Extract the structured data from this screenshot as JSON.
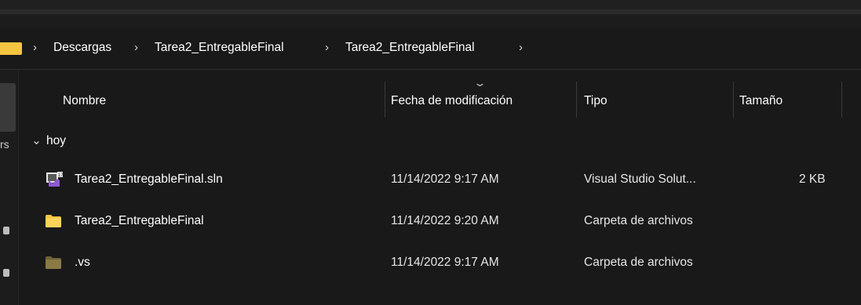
{
  "breadcrumb": {
    "items": [
      "Descargas",
      "Tarea2_EntregableFinal",
      "Tarea2_EntregableFinal"
    ],
    "separator": "›"
  },
  "leftpane": {
    "truncated_text": "rs"
  },
  "columns": {
    "name": "Nombre",
    "modified": "Fecha de modificación",
    "type": "Tipo",
    "size": "Tamaño"
  },
  "group": {
    "label": "hoy",
    "chevron": "⌄"
  },
  "files": [
    {
      "name": "Tarea2_EntregableFinal.sln",
      "modified": "11/14/2022 9:17 AM",
      "type": "Visual Studio Solut...",
      "size": "2 KB",
      "icon": "visual-studio-solution-icon"
    },
    {
      "name": "Tarea2_EntregableFinal",
      "modified": "11/14/2022 9:20 AM",
      "type": "Carpeta de archivos",
      "size": "",
      "icon": "folder-icon"
    },
    {
      "name": ".vs",
      "modified": "11/14/2022 9:17 AM",
      "type": "Carpeta de archivos",
      "size": "",
      "icon": "hidden-folder-icon"
    }
  ],
  "colors": {
    "background": "#191919",
    "folder": "#f5c541",
    "hidden_folder": "#8a7a45",
    "vs_purple": "#8e59d1"
  }
}
